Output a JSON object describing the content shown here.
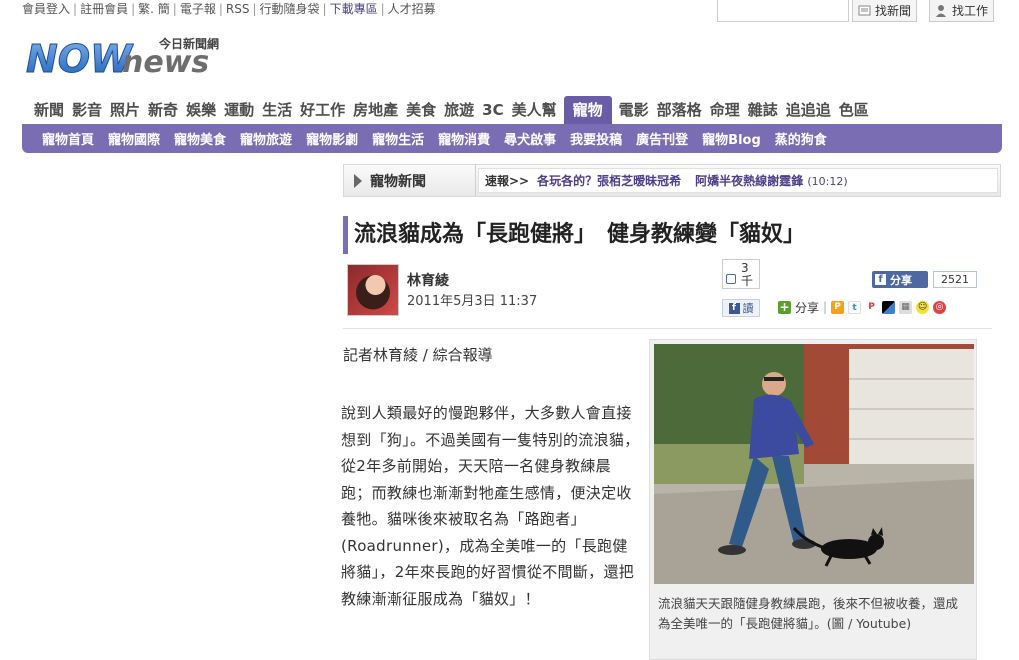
{
  "toplinks": [
    {
      "label": "會員登入"
    },
    {
      "label": "註冊會員"
    },
    {
      "label": "繁. 簡"
    },
    {
      "label": "電子報"
    },
    {
      "label": "RSS"
    },
    {
      "label": "行動隨身袋"
    },
    {
      "label": "下載專區",
      "highlight": true
    },
    {
      "label": "人才招募"
    }
  ],
  "search": {
    "placeholder": ""
  },
  "top_buttons": {
    "find_news": "找新聞",
    "find_job": "找工作"
  },
  "logo": {
    "main": "NOWnews",
    "sub": "今日新聞網"
  },
  "main_nav": [
    "新聞",
    "影音",
    "照片",
    "新奇",
    "娛樂",
    "運動",
    "生活",
    "好工作",
    "房地產",
    "美食",
    "旅遊",
    "3C",
    "美人幫",
    "寵物",
    "電影",
    "部落格",
    "命理",
    "雜誌",
    "追追追",
    "色區"
  ],
  "main_nav_active": "寵物",
  "sub_nav": [
    "寵物首頁",
    "寵物國際",
    "寵物美食",
    "寵物旅遊",
    "寵物影劇",
    "寵物生活",
    "寵物消費",
    "尋犬啟事",
    "我要投稿",
    "廣告刊登",
    "寵物Blog",
    "蒸的狗食"
  ],
  "section": {
    "label": "寵物新聞",
    "ticker_label": "速報>>",
    "ticker_item1": "各玩各的？張栢芝暧昧冠希",
    "ticker_item2": "阿嬌半夜熱線謝霆鋒",
    "ticker_time": "(10:12)"
  },
  "article": {
    "title": "流浪貓成為「長跑健將」　健身教練變「貓奴」",
    "author": "林育綾",
    "date": "2011年5月3日 11:37",
    "byline": "記者林育綾 / 綜合報導",
    "body": "說到人類最好的慢跑夥伴，大多數人會直接想到「狗」。不過美國有一隻特別的流浪貓，從2年多前開始，天天陪一名健身教練晨跑；而教練也漸漸對牠產生感情，便決定收養牠。貓咪後來被取名為「路跑者」(Roadrunner)，成為全美唯一的「長跑健將貓」，2年來長跑的好習慣從不間斷，還把教練漸漸征服成為「貓奴」！",
    "caption": "流浪貓天天跟隨健身教練晨跑，後來不但被收養，還成為全美唯一的「長跑健將貓」。(圖 / Youtube)"
  },
  "social": {
    "like_count": "3\n千",
    "fb_read": "讀",
    "fb_share": "分享",
    "share_count": "2521",
    "share_label": "分享"
  },
  "colors": {
    "brand_purple": "#7b6db3",
    "active_tab": "#6a5ca6",
    "link_purple": "#4e3f8a",
    "fb_blue": "#4e69a2"
  }
}
